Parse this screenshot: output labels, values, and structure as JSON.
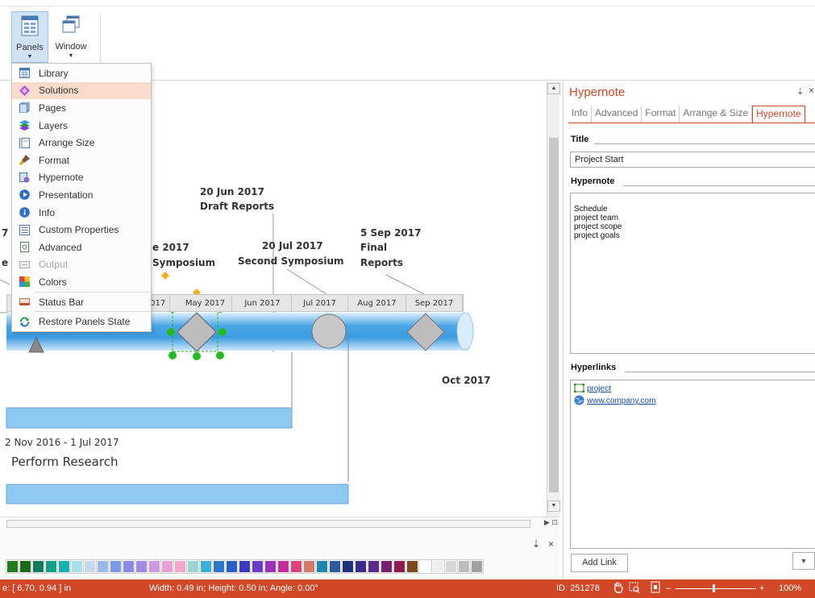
{
  "ribbon": {
    "buttons": [
      {
        "label": "Panels",
        "icon": "panels-icon"
      },
      {
        "label": "Window",
        "icon": "window-icon"
      }
    ]
  },
  "menu": {
    "items": [
      {
        "label": "Library",
        "icon": "library-icon",
        "state": "normal"
      },
      {
        "label": "Solutions",
        "icon": "solutions-icon",
        "state": "highlighted"
      },
      {
        "label": "Pages",
        "icon": "pages-icon",
        "state": "normal"
      },
      {
        "label": "Layers",
        "icon": "layers-icon",
        "state": "normal"
      },
      {
        "label": "Arrange Size",
        "icon": "arrange-size-icon",
        "state": "normal"
      },
      {
        "label": "Format",
        "icon": "format-brush-icon",
        "state": "normal"
      },
      {
        "label": "Hypernote",
        "icon": "hypernote-icon",
        "state": "normal"
      },
      {
        "label": "Presentation",
        "icon": "presentation-play-icon",
        "state": "normal"
      },
      {
        "label": "Info",
        "icon": "info-icon",
        "state": "normal"
      },
      {
        "label": "Custom Properties",
        "icon": "custom-properties-icon",
        "state": "normal"
      },
      {
        "label": "Advanced",
        "icon": "advanced-icon",
        "state": "normal"
      },
      {
        "label": "Output",
        "icon": "output-icon",
        "state": "disabled"
      },
      {
        "label": "Colors",
        "icon": "colors-icon",
        "state": "normal"
      },
      {
        "label": "Status Bar",
        "icon": "status-bar-icon",
        "state": "normal"
      },
      {
        "label": "Restore Panels State",
        "icon": "restore-icon",
        "state": "normal"
      }
    ]
  },
  "canvas": {
    "milestones": [
      {
        "date": "20 Jun 2017",
        "title": "Draft Reports"
      },
      {
        "date": "20 Jul 2017",
        "title": "Second Symposium"
      },
      {
        "date": "5 Sep 2017",
        "title1": "Final",
        "title2": "Reports"
      }
    ],
    "partial_milestone": {
      "date": "e 2017",
      "title": "Symposium"
    },
    "cut_labels": {
      "seven": "7",
      "e": "e"
    },
    "timeline_ticks": [
      "2017",
      "May 2017",
      "Jun 2017",
      "Jul 2017",
      "Aug 2017",
      "Sep 2017"
    ],
    "end_label": "Oct 2017",
    "task": {
      "range": "2 Nov 2016 - 1 Jul 2017",
      "name": "Perform Research"
    }
  },
  "panel": {
    "title": "Hypernote",
    "pin": "⇣",
    "close": "×",
    "tabs": [
      "Info",
      "Advanced",
      "Format",
      "Arrange & Size",
      "Hypernote"
    ],
    "active_tab": "Hypernote",
    "title_label": "Title",
    "title_value": "Project Start",
    "hypernote_label": "Hypernote",
    "hypernote_lines": [
      "Schedule",
      "project team",
      "project scope",
      "project goals"
    ],
    "hyperlinks_label": "Hyperlinks",
    "hyperlinks": [
      {
        "text": "project",
        "icon": "page-link-icon"
      },
      {
        "text": "www.company.com",
        "icon": "globe-icon"
      }
    ],
    "add_link_label": "Add Link"
  },
  "palette": {
    "colors": [
      "#1e7b1e",
      "#1a6a1a",
      "#137a5a",
      "#11a08a",
      "#17b0b0",
      "#a8e0ea",
      "#c5d8f0",
      "#9ab8e8",
      "#7a9ae6",
      "#8a8ae8",
      "#a08ae8",
      "#cc99e0",
      "#e8a0d6",
      "#f4a6c8",
      "#9ad4d4",
      "#3ab0d8",
      "#2f77c8",
      "#2b5fc4",
      "#3a3ac0",
      "#6a3ac8",
      "#9a32b8",
      "#c42d9a",
      "#e0407a",
      "#d47a68",
      "#1f86b0",
      "#2a5aa0",
      "#20307a",
      "#3a2a8a",
      "#5a2a8a",
      "#7a1f6f",
      "#8f1a4c",
      "#7a4a1a",
      "#ffffff",
      "#eeeeee",
      "#d6d6d6",
      "#bdbdbd",
      "#a0a0a0"
    ],
    "pin": "⇣",
    "close": "×"
  },
  "statusbar": {
    "position": "e: [ 6.70, 0.94 ] in",
    "size": "Width: 0.49 in;  Height: 0.50 in;  Angle: 0.00°",
    "id": "ID: 251278",
    "zoom": "100%",
    "zoom_minus": "–",
    "zoom_plus": "+",
    "color": "#d24726"
  },
  "colors": {
    "accent": "#d24726",
    "timeline_blue": "#5aaee8",
    "selection_green": "#22bb22"
  }
}
